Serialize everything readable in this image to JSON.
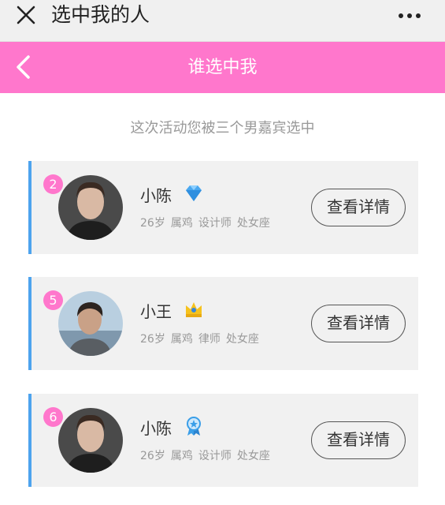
{
  "wechat_bar": {
    "title": "选中我的人"
  },
  "header": {
    "title": "谁选中我"
  },
  "subtitle": "这次活动您被三个男嘉宾选中",
  "accent_color": "#ff77cc",
  "card_border_color": "#4da3ee",
  "cards": [
    {
      "badge": "2",
      "name": "小陈",
      "level_icon": "diamond-icon",
      "age": "26岁",
      "zodiac": "属鸡",
      "job": "设计师",
      "constellation": "处女座",
      "button": "查看详情"
    },
    {
      "badge": "5",
      "name": "小王",
      "level_icon": "crown-icon",
      "age": "26岁",
      "zodiac": "属鸡",
      "job": "律师",
      "constellation": "处女座",
      "button": "查看详情"
    },
    {
      "badge": "6",
      "name": "小陈",
      "level_icon": "medal-icon",
      "age": "26岁",
      "zodiac": "属鸡",
      "job": "设计师",
      "constellation": "处女座",
      "button": "查看详情"
    }
  ]
}
